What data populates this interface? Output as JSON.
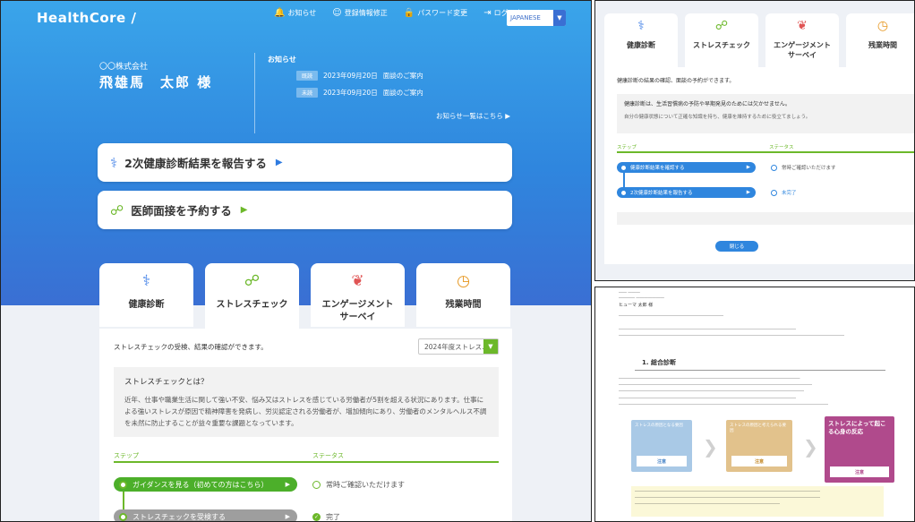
{
  "main": {
    "logo": "HealthCore /",
    "nav": {
      "notifications": "お知らせ",
      "registration": "登録情報修正",
      "password": "パスワード変更",
      "logout": "ログアウト"
    },
    "language": "JAPANESE",
    "company": "〇〇株式会社",
    "user_name": "飛雄馬　太郎 様",
    "notices_title": "お知らせ",
    "notices": [
      {
        "badge": "既読",
        "date": "2023年09月20日",
        "text": "面談のご案内"
      },
      {
        "badge": "未読",
        "date": "2023年09月20日",
        "text": "面談のご案内"
      }
    ],
    "notices_more": "お知らせ一覧はこちら ▶",
    "actions": [
      {
        "label": "2次健康診断結果を報告する",
        "arrow": "▶"
      },
      {
        "label": "医師面接を予約する",
        "arrow": "▶"
      }
    ],
    "tabs": [
      {
        "label": "健康診断"
      },
      {
        "label": "ストレスチェック"
      },
      {
        "label": "エンゲージメント\nサーベイ"
      },
      {
        "label": "残業時間"
      }
    ],
    "content": {
      "intro": "ストレスチェックの受検、結果の確認ができます。",
      "year_select": "2024年度ストレス...",
      "info_heading": "ストレスチェックとは？",
      "info_body": "近年、仕事や職業生活に関して強い不安、悩み又はストレスを感じている労働者が5割を超える状況にあります。仕事による強いストレスが原因で精神障害を発病し、労災認定される労働者が、増加傾向にあり、労働者のメンタルヘルス不調を未然に防止することが益々重要な課題となっています。",
      "steps_label": "ステップ",
      "status_label": "ステータス",
      "steps": [
        {
          "label": "ガイダンスを見る（初めての方はこちら）",
          "status": "常時ご確認いただけます"
        },
        {
          "label": "ストレスチェックを受検する",
          "status": "完了"
        }
      ]
    }
  },
  "right_top": {
    "tabs": [
      {
        "label": "健康診断"
      },
      {
        "label": "ストレスチェック"
      },
      {
        "label": "エンゲージメント\nサーベイ"
      },
      {
        "label": "残業時間"
      }
    ],
    "intro": "健康診断の結果の確認、面談の予約ができます。",
    "box_heading": "健康診断は、生活習慣病の予防や早期発見のためには欠かせません。",
    "box_body": "自分の健康状態について正確な知識を持ち、健康を維持するために役立てましょう。",
    "steps_label": "ステップ",
    "status_label": "ステータス",
    "steps": [
      {
        "label": "健康診断結果を確認する",
        "status": "常時ご確認いただけます"
      },
      {
        "label": "2次健康診断結果を報告する",
        "status": "未完了"
      }
    ],
    "close": "閉じる"
  },
  "right_bottom": {
    "section_title": "1. 総合診断",
    "name": "ヒューマ 太郎 様",
    "cards": [
      {
        "title": "ストレスの原因となる要因",
        "button": "注意"
      },
      {
        "title": "ストレスの原因と考えられる要因",
        "button": "注意"
      },
      {
        "title": "ストレスによって起こる心身の反応",
        "button": "注意"
      }
    ]
  },
  "colors": {
    "hero_top": "#3aa5ea",
    "hero_bottom": "#3a6fd3",
    "accent_green": "#6cb82a",
    "accent_blue": "#2f86de"
  }
}
